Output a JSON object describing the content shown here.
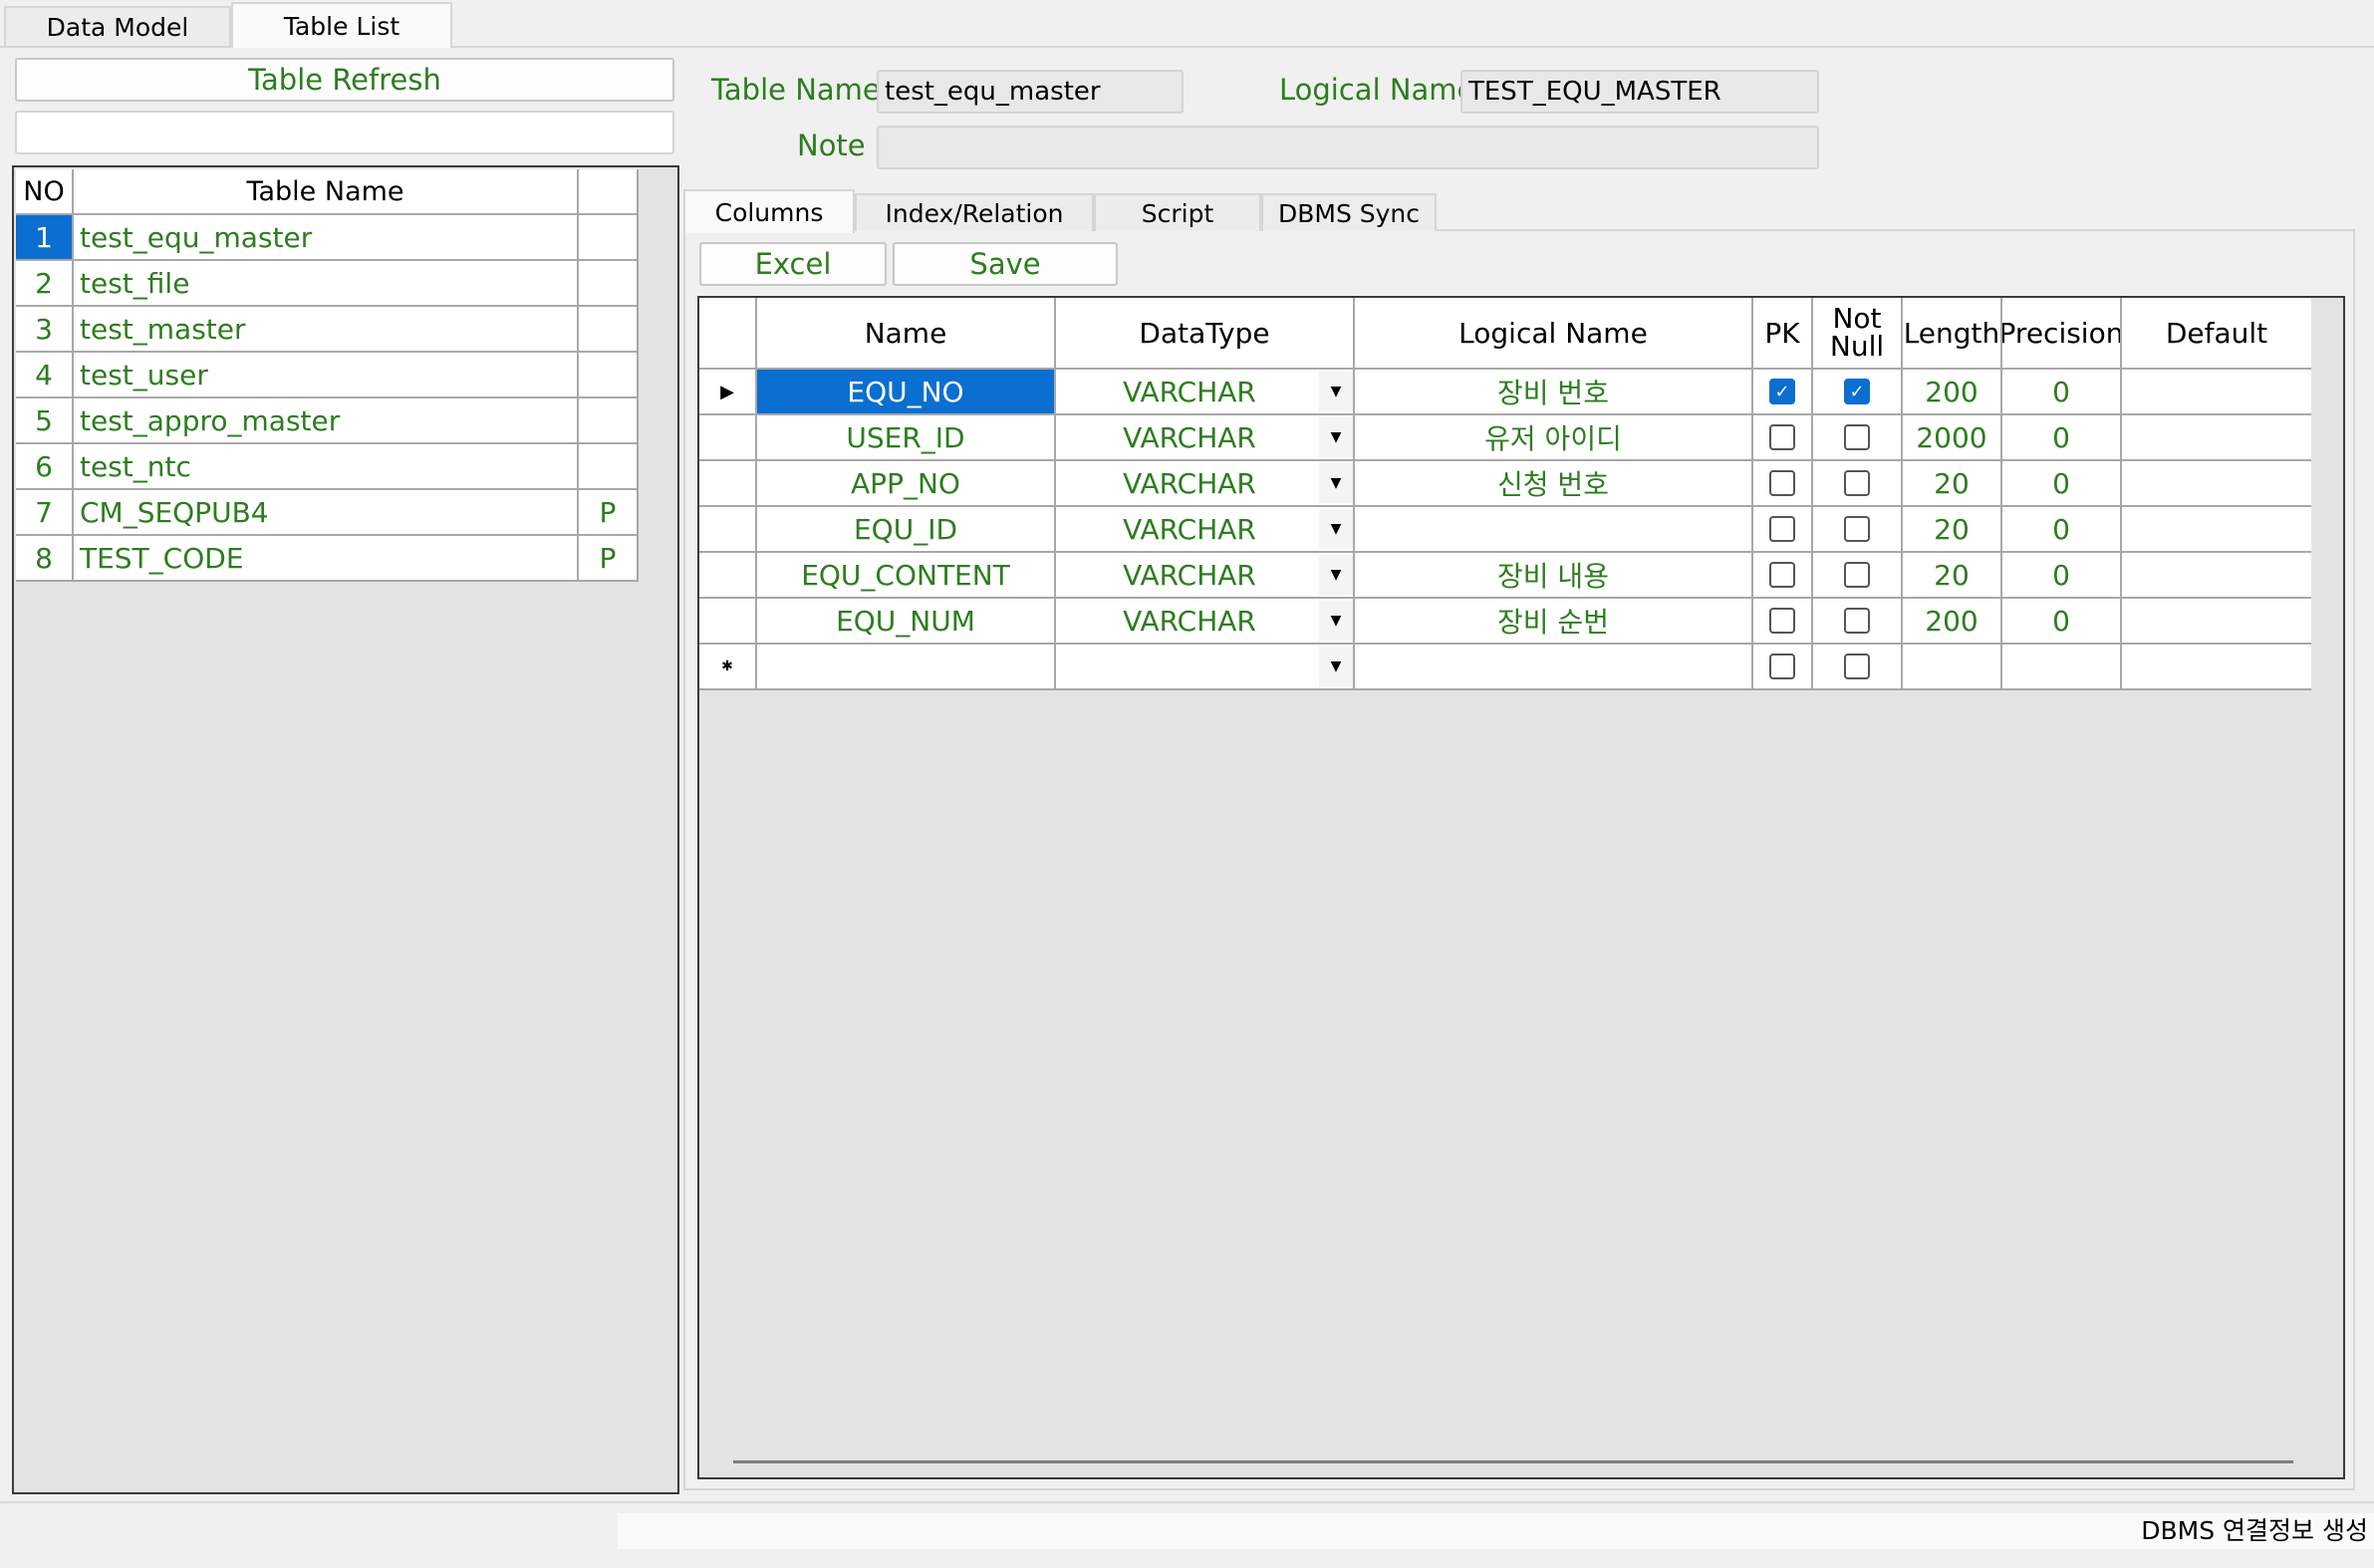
{
  "tabs": {
    "data_model": "Data Model",
    "table_list": "Table List"
  },
  "left": {
    "refresh_button": "Table Refresh",
    "filter_value": "",
    "headers": {
      "no": "NO",
      "name": "Table Name",
      "p": ""
    },
    "rows": [
      {
        "no": "1",
        "name": "test_equ_master",
        "p": ""
      },
      {
        "no": "2",
        "name": "test_file",
        "p": ""
      },
      {
        "no": "3",
        "name": "test_master",
        "p": ""
      },
      {
        "no": "4",
        "name": "test_user",
        "p": ""
      },
      {
        "no": "5",
        "name": "test_appro_master",
        "p": ""
      },
      {
        "no": "6",
        "name": "test_ntc",
        "p": ""
      },
      {
        "no": "7",
        "name": "CM_SEQPUB4",
        "p": "P"
      },
      {
        "no": "8",
        "name": "TEST_CODE",
        "p": "P"
      }
    ]
  },
  "detail": {
    "table_name_label": "Table Name",
    "table_name_value": "test_equ_master",
    "logical_name_label": "Logical Name",
    "logical_name_value": "TEST_EQU_MASTER",
    "note_label": "Note",
    "note_value": ""
  },
  "subtabs": {
    "columns": "Columns",
    "index": "Index/Relation",
    "script": "Script",
    "dbms": "DBMS Sync"
  },
  "buttons": {
    "excel": "Excel",
    "save": "Save"
  },
  "grid": {
    "headers": {
      "name": "Name",
      "datatype": "DataType",
      "logical": "Logical Name",
      "pk": "PK",
      "notnull_1": "Not",
      "notnull_2": "Null",
      "length": "Length",
      "precision": "Precision",
      "default": "Default"
    },
    "rows": [
      {
        "name": "EQU_NO",
        "type": "VARCHAR",
        "logical": "장비 번호",
        "pk": true,
        "nn": true,
        "length": "200",
        "precision": "0",
        "default": ""
      },
      {
        "name": "USER_ID",
        "type": "VARCHAR",
        "logical": "유저 아이디",
        "pk": false,
        "nn": false,
        "length": "2000",
        "precision": "0",
        "default": ""
      },
      {
        "name": "APP_NO",
        "type": "VARCHAR",
        "logical": "신청 번호",
        "pk": false,
        "nn": false,
        "length": "20",
        "precision": "0",
        "default": ""
      },
      {
        "name": "EQU_ID",
        "type": "VARCHAR",
        "logical": "",
        "pk": false,
        "nn": false,
        "length": "20",
        "precision": "0",
        "default": ""
      },
      {
        "name": "EQU_CONTENT",
        "type": "VARCHAR",
        "logical": "장비 내용",
        "pk": false,
        "nn": false,
        "length": "20",
        "precision": "0",
        "default": ""
      },
      {
        "name": "EQU_NUM",
        "type": "VARCHAR",
        "logical": "장비 순번",
        "pk": false,
        "nn": false,
        "length": "200",
        "precision": "0",
        "default": ""
      }
    ]
  },
  "status": {
    "text": "DBMS 연결정보 생성"
  },
  "colors": {
    "accent": "#0a6fd0",
    "text_green": "#2d7d1f"
  }
}
